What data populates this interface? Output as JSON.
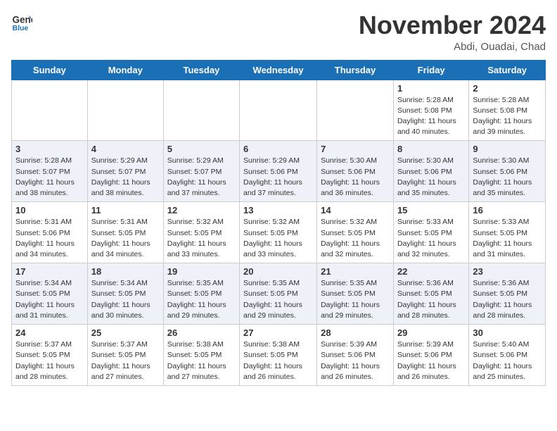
{
  "header": {
    "logo_line1": "General",
    "logo_line2": "Blue",
    "month_title": "November 2024",
    "location": "Abdi, Ouadai, Chad"
  },
  "weekdays": [
    "Sunday",
    "Monday",
    "Tuesday",
    "Wednesday",
    "Thursday",
    "Friday",
    "Saturday"
  ],
  "weeks": [
    [
      {
        "day": "",
        "info": ""
      },
      {
        "day": "",
        "info": ""
      },
      {
        "day": "",
        "info": ""
      },
      {
        "day": "",
        "info": ""
      },
      {
        "day": "",
        "info": ""
      },
      {
        "day": "1",
        "info": "Sunrise: 5:28 AM\nSunset: 5:08 PM\nDaylight: 11 hours\nand 40 minutes."
      },
      {
        "day": "2",
        "info": "Sunrise: 5:28 AM\nSunset: 5:08 PM\nDaylight: 11 hours\nand 39 minutes."
      }
    ],
    [
      {
        "day": "3",
        "info": "Sunrise: 5:28 AM\nSunset: 5:07 PM\nDaylight: 11 hours\nand 38 minutes."
      },
      {
        "day": "4",
        "info": "Sunrise: 5:29 AM\nSunset: 5:07 PM\nDaylight: 11 hours\nand 38 minutes."
      },
      {
        "day": "5",
        "info": "Sunrise: 5:29 AM\nSunset: 5:07 PM\nDaylight: 11 hours\nand 37 minutes."
      },
      {
        "day": "6",
        "info": "Sunrise: 5:29 AM\nSunset: 5:06 PM\nDaylight: 11 hours\nand 37 minutes."
      },
      {
        "day": "7",
        "info": "Sunrise: 5:30 AM\nSunset: 5:06 PM\nDaylight: 11 hours\nand 36 minutes."
      },
      {
        "day": "8",
        "info": "Sunrise: 5:30 AM\nSunset: 5:06 PM\nDaylight: 11 hours\nand 35 minutes."
      },
      {
        "day": "9",
        "info": "Sunrise: 5:30 AM\nSunset: 5:06 PM\nDaylight: 11 hours\nand 35 minutes."
      }
    ],
    [
      {
        "day": "10",
        "info": "Sunrise: 5:31 AM\nSunset: 5:06 PM\nDaylight: 11 hours\nand 34 minutes."
      },
      {
        "day": "11",
        "info": "Sunrise: 5:31 AM\nSunset: 5:05 PM\nDaylight: 11 hours\nand 34 minutes."
      },
      {
        "day": "12",
        "info": "Sunrise: 5:32 AM\nSunset: 5:05 PM\nDaylight: 11 hours\nand 33 minutes."
      },
      {
        "day": "13",
        "info": "Sunrise: 5:32 AM\nSunset: 5:05 PM\nDaylight: 11 hours\nand 33 minutes."
      },
      {
        "day": "14",
        "info": "Sunrise: 5:32 AM\nSunset: 5:05 PM\nDaylight: 11 hours\nand 32 minutes."
      },
      {
        "day": "15",
        "info": "Sunrise: 5:33 AM\nSunset: 5:05 PM\nDaylight: 11 hours\nand 32 minutes."
      },
      {
        "day": "16",
        "info": "Sunrise: 5:33 AM\nSunset: 5:05 PM\nDaylight: 11 hours\nand 31 minutes."
      }
    ],
    [
      {
        "day": "17",
        "info": "Sunrise: 5:34 AM\nSunset: 5:05 PM\nDaylight: 11 hours\nand 31 minutes."
      },
      {
        "day": "18",
        "info": "Sunrise: 5:34 AM\nSunset: 5:05 PM\nDaylight: 11 hours\nand 30 minutes."
      },
      {
        "day": "19",
        "info": "Sunrise: 5:35 AM\nSunset: 5:05 PM\nDaylight: 11 hours\nand 29 minutes."
      },
      {
        "day": "20",
        "info": "Sunrise: 5:35 AM\nSunset: 5:05 PM\nDaylight: 11 hours\nand 29 minutes."
      },
      {
        "day": "21",
        "info": "Sunrise: 5:35 AM\nSunset: 5:05 PM\nDaylight: 11 hours\nand 29 minutes."
      },
      {
        "day": "22",
        "info": "Sunrise: 5:36 AM\nSunset: 5:05 PM\nDaylight: 11 hours\nand 28 minutes."
      },
      {
        "day": "23",
        "info": "Sunrise: 5:36 AM\nSunset: 5:05 PM\nDaylight: 11 hours\nand 28 minutes."
      }
    ],
    [
      {
        "day": "24",
        "info": "Sunrise: 5:37 AM\nSunset: 5:05 PM\nDaylight: 11 hours\nand 28 minutes."
      },
      {
        "day": "25",
        "info": "Sunrise: 5:37 AM\nSunset: 5:05 PM\nDaylight: 11 hours\nand 27 minutes."
      },
      {
        "day": "26",
        "info": "Sunrise: 5:38 AM\nSunset: 5:05 PM\nDaylight: 11 hours\nand 27 minutes."
      },
      {
        "day": "27",
        "info": "Sunrise: 5:38 AM\nSunset: 5:05 PM\nDaylight: 11 hours\nand 26 minutes."
      },
      {
        "day": "28",
        "info": "Sunrise: 5:39 AM\nSunset: 5:06 PM\nDaylight: 11 hours\nand 26 minutes."
      },
      {
        "day": "29",
        "info": "Sunrise: 5:39 AM\nSunset: 5:06 PM\nDaylight: 11 hours\nand 26 minutes."
      },
      {
        "day": "30",
        "info": "Sunrise: 5:40 AM\nSunset: 5:06 PM\nDaylight: 11 hours\nand 25 minutes."
      }
    ]
  ]
}
